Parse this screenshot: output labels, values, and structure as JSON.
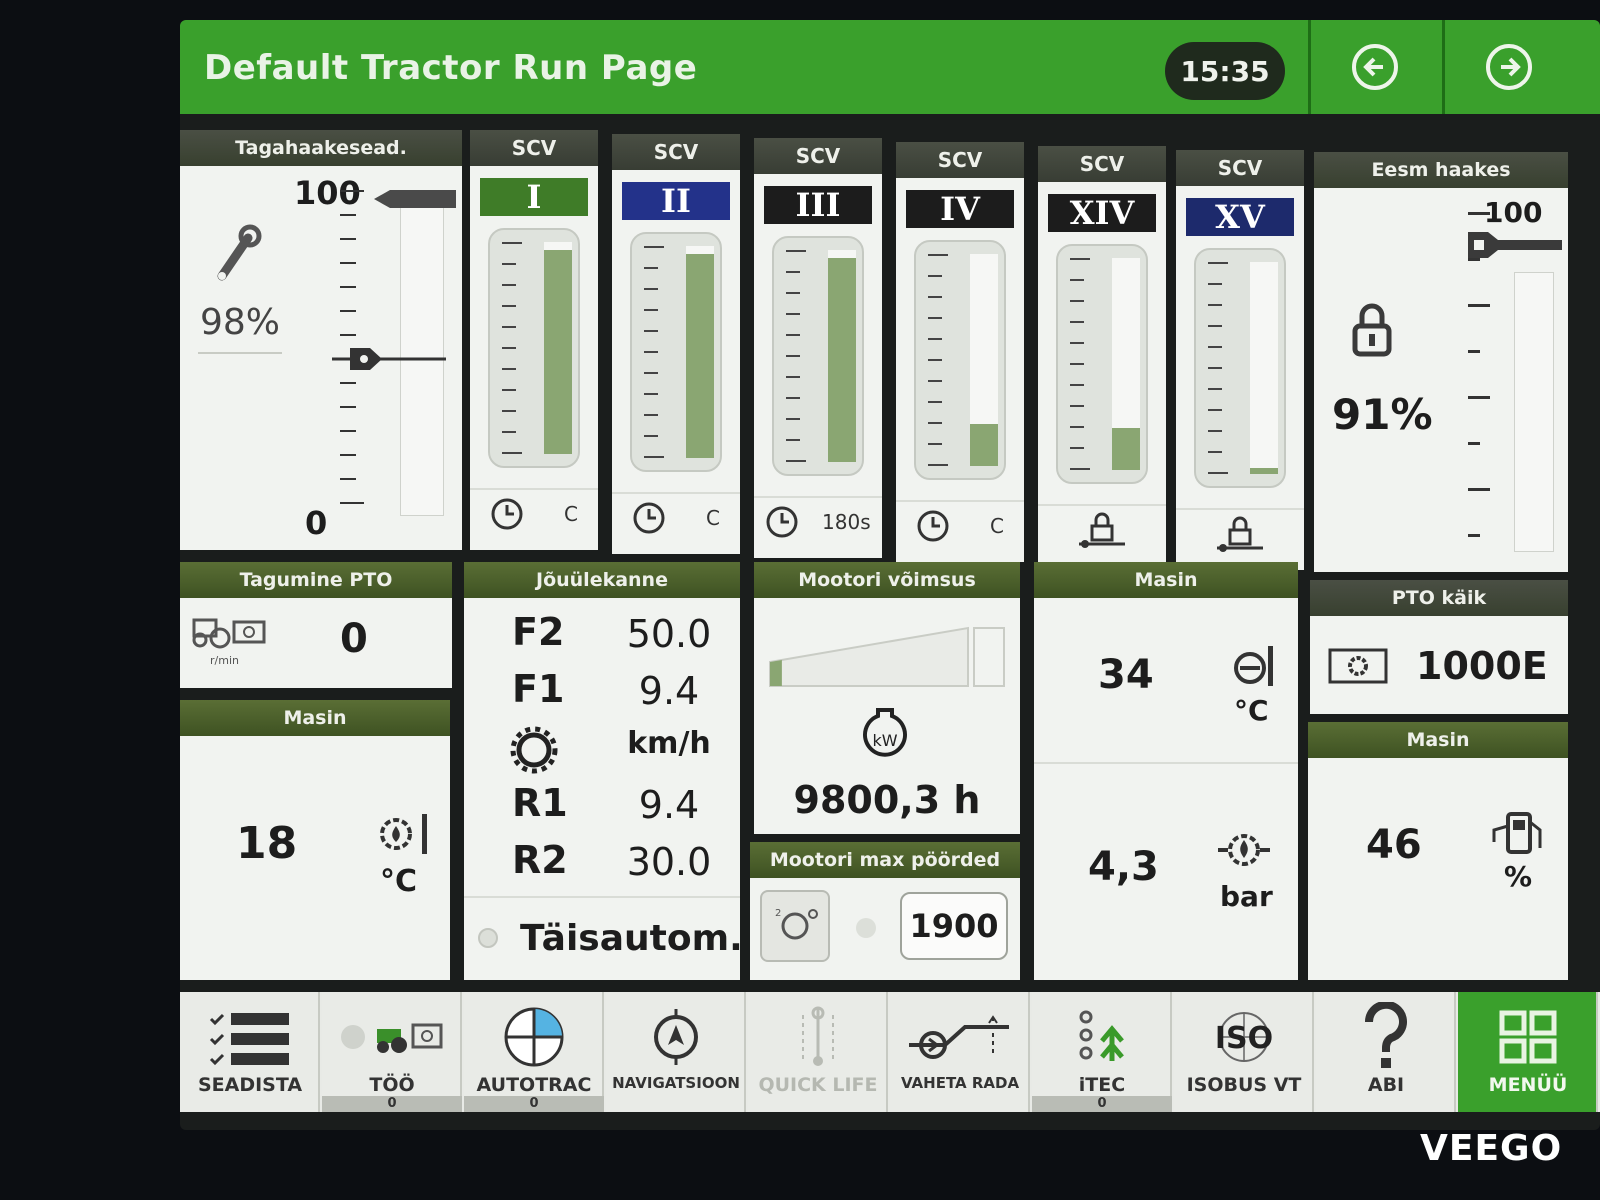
{
  "header": {
    "title": "Default Tractor Run Page",
    "time": "15:35"
  },
  "rear_hitch": {
    "title": "Tagahaakesead.",
    "max_label": "100",
    "min_label": "0",
    "percent": "98%",
    "position_fraction": 0.5
  },
  "front_hitch": {
    "title": "Eesm haakes",
    "max_label": "100",
    "percent": "91%"
  },
  "scvs": [
    {
      "head": "SCV",
      "num": "I",
      "color": "green",
      "fill": 0.96,
      "foot": "C",
      "timer": true
    },
    {
      "head": "SCV",
      "num": "II",
      "color": "blue",
      "fill": 0.96,
      "foot": "C",
      "timer": true
    },
    {
      "head": "SCV",
      "num": "III",
      "color": "black",
      "fill": 0.96,
      "foot": "180s",
      "timer": true
    },
    {
      "head": "SCV",
      "num": "IV",
      "color": "black",
      "fill": 0.2,
      "foot": "C",
      "timer": true
    },
    {
      "head": "SCV",
      "num": "XIV",
      "color": "black",
      "fill": 0.2,
      "foot": "",
      "timer": false
    },
    {
      "head": "SCV",
      "num": "XV",
      "color": "navy",
      "fill": 0.03,
      "foot": "",
      "timer": false
    }
  ],
  "rear_pto": {
    "title": "Tagumine PTO",
    "value": "0",
    "unit": "r/min"
  },
  "transmission": {
    "title": "Jõuülekanne",
    "rows": [
      {
        "gear": "F2",
        "value": "50.0"
      },
      {
        "gear": "F1",
        "value": "9.4"
      },
      {
        "gear": "",
        "value": "km/h"
      },
      {
        "gear": "R1",
        "value": "9.4"
      },
      {
        "gear": "R2",
        "value": "30.0"
      }
    ],
    "mode": "Täisautom."
  },
  "engine_power": {
    "title": "Mootori võimsus",
    "unit_icon": "kW",
    "hours": "9800,3 h",
    "level": 0.06
  },
  "engine_max_rpm": {
    "title": "Mootori max pöörded",
    "value": "1900"
  },
  "machine_temp_left": {
    "title": "Masin",
    "value": "18",
    "unit": "°C"
  },
  "machine_center": {
    "title": "Masin",
    "coolant_value": "34",
    "coolant_unit": "°C",
    "oil_pressure_value": "4,3",
    "oil_pressure_unit": "bar"
  },
  "pto_gear": {
    "title": "PTO käik",
    "value": "1000E"
  },
  "machine_right": {
    "title": "Masin",
    "value": "46",
    "unit": "%"
  },
  "bottom_nav": [
    {
      "label": "SEADISTA",
      "icon": "settings-list-icon",
      "sub": ""
    },
    {
      "label": "TÖÖ",
      "icon": "work-icon",
      "sub": "0"
    },
    {
      "label": "AUTOTRAC",
      "icon": "autotrac-icon",
      "sub": "0"
    },
    {
      "label": "NAVIGATSIOON",
      "icon": "navigation-icon",
      "sub": ""
    },
    {
      "label": "QUICK LIFE",
      "icon": "quick-life-icon",
      "sub": ""
    },
    {
      "label": "VAHETA RADA",
      "icon": "change-track-icon",
      "sub": ""
    },
    {
      "label": "iTEC",
      "icon": "itec-icon",
      "sub": "0"
    },
    {
      "label": "ISOBUS VT",
      "icon": "isobus-icon",
      "sub": ""
    },
    {
      "label": "ABI",
      "icon": "help-icon",
      "sub": ""
    },
    {
      "label": "MENÜÜ",
      "icon": "menu-grid-icon",
      "sub": ""
    }
  ],
  "watermark": "VEEGO",
  "colors": {
    "header_green": "#3aa02c",
    "panel_title": "#4a4f44",
    "gauge_fill": "#8aa672"
  }
}
